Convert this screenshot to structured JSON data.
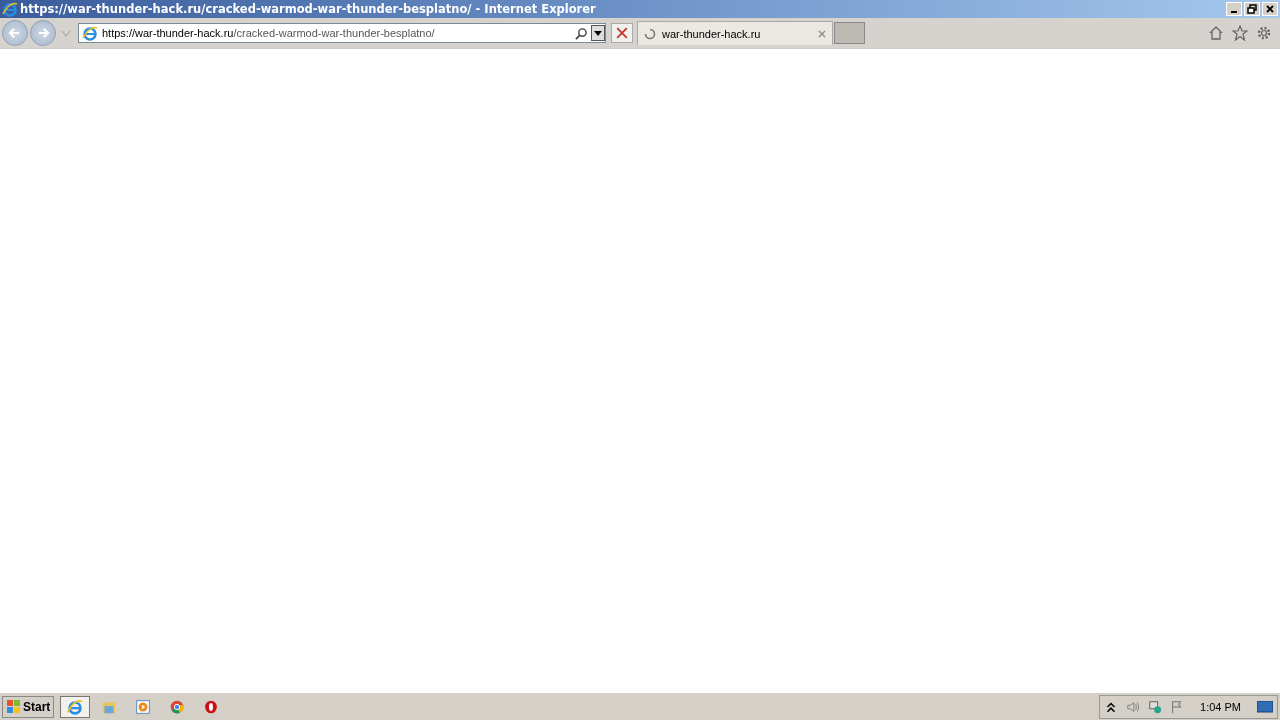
{
  "window": {
    "title": "https://war-thunder-hack.ru/cracked-warmod-war-thunder-besplatno/ - Internet Explorer"
  },
  "address_bar": {
    "host": "https://war-thunder-hack.ru",
    "path": "/cracked-warmod-war-thunder-besplatno/"
  },
  "tabs": [
    {
      "label": "war-thunder-hack.ru",
      "selected": true,
      "loading": true
    }
  ],
  "taskbar": {
    "start": "Start",
    "apps": [
      {
        "kind": "ie",
        "selected": true
      },
      {
        "kind": "folder",
        "selected": false
      },
      {
        "kind": "media",
        "selected": false
      },
      {
        "kind": "chrome",
        "selected": false
      },
      {
        "kind": "opera",
        "selected": false
      }
    ],
    "clock": "1:04 PM"
  }
}
